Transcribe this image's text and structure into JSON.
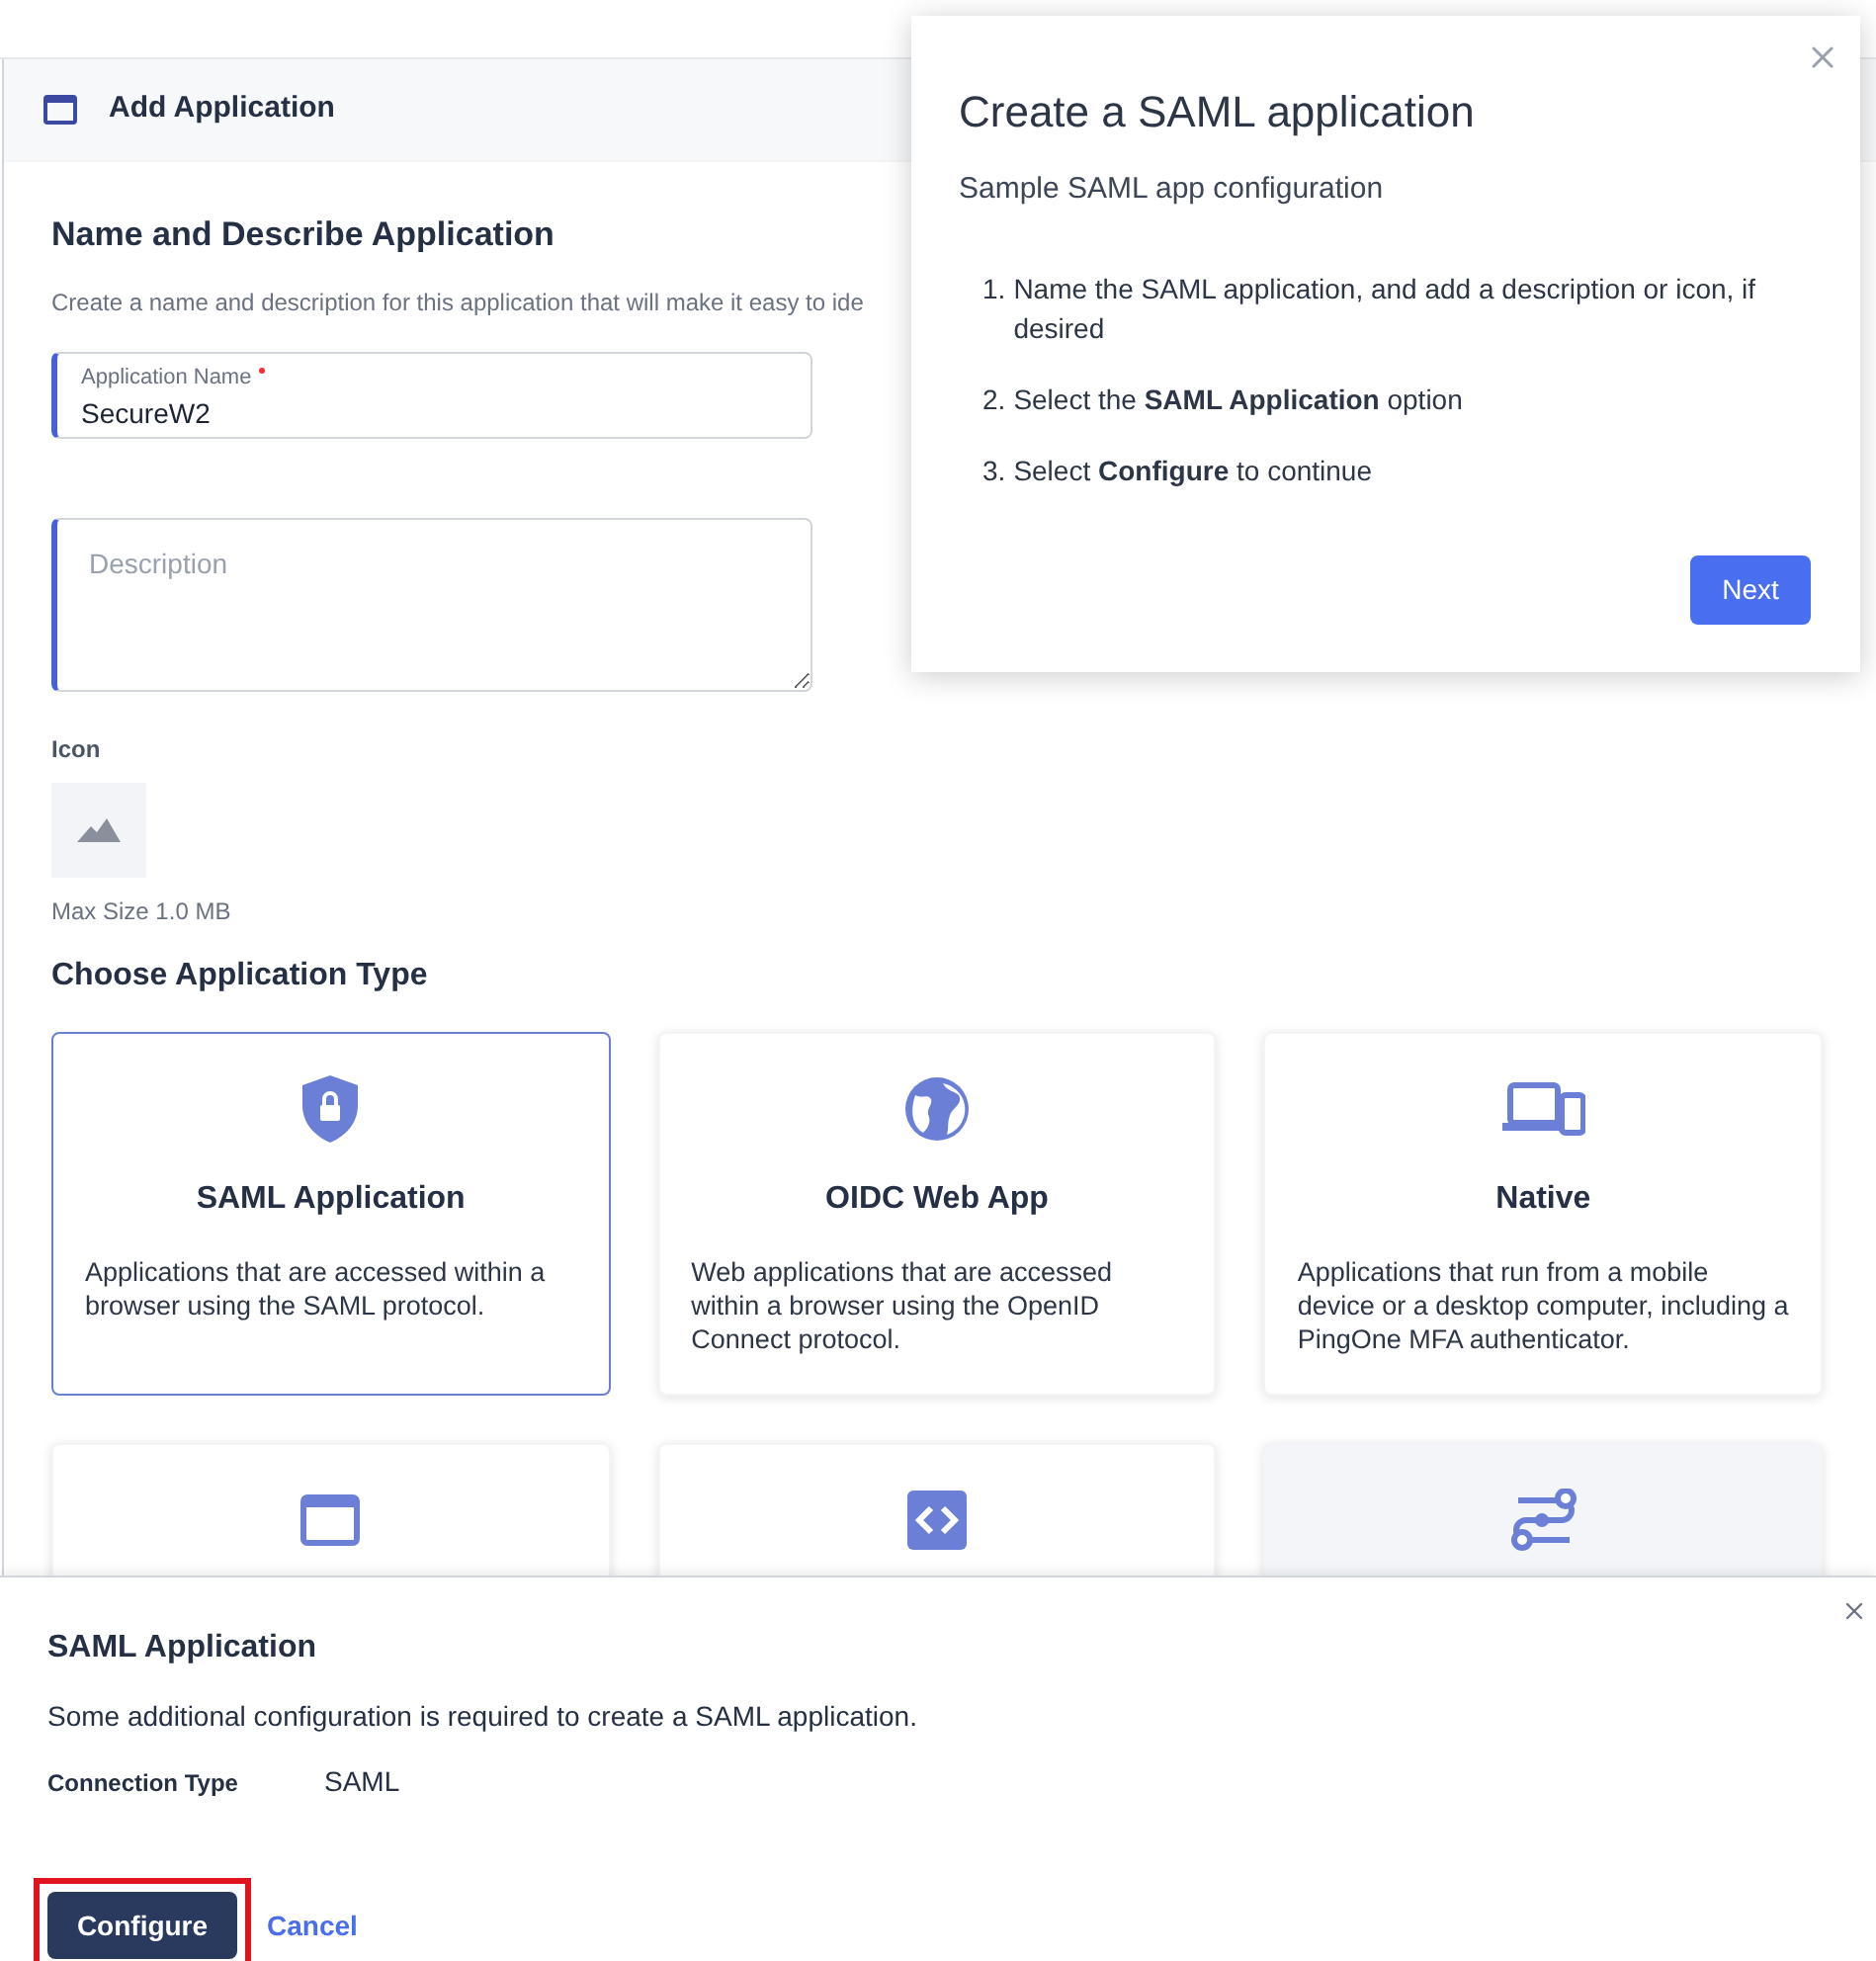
{
  "header": {
    "title": "Add Application"
  },
  "form": {
    "heading": "Name and Describe Application",
    "intro": "Create a name and description for this application that will make it easy to ide",
    "name_field": {
      "label": "Application Name",
      "required": true,
      "value": "SecureW2"
    },
    "description_field": {
      "placeholder": "Description"
    },
    "icon_label": "Icon",
    "icon_hint": "Max Size 1.0 MB"
  },
  "app_types": {
    "heading": "Choose Application Type",
    "cards": [
      {
        "kind": "shield",
        "title": "SAML Application",
        "text": "Applications that are accessed within a browser using the SAML protocol.",
        "selected": true,
        "hovered": false
      },
      {
        "kind": "globe",
        "title": "OIDC Web App",
        "text": "Web applications that are accessed within a browser using the OpenID Connect protocol.",
        "selected": false,
        "hovered": false
      },
      {
        "kind": "devices",
        "title": "Native",
        "text": "Applications that run from a mobile device or a desktop computer, including a PingOne MFA authenticator.",
        "selected": false,
        "hovered": false
      },
      {
        "kind": "window",
        "selected": false,
        "hovered": false
      },
      {
        "kind": "code",
        "selected": false,
        "hovered": false
      },
      {
        "kind": "flow",
        "selected": false,
        "hovered": true
      }
    ]
  },
  "guide_popover": {
    "title": "Create a SAML application",
    "subtitle": "Sample SAML app configuration",
    "steps": [
      "Name the SAML application, and add a description or icon, if desired",
      "Select the **SAML Application** option",
      "Select **Configure** to continue"
    ],
    "step_numbers": [
      "1.",
      "2.",
      "3."
    ],
    "next_button": "Next"
  },
  "config_panel": {
    "title": "SAML Application",
    "text": "Some additional configuration is required to create a SAML application.",
    "connection_type_label": "Connection Type",
    "connection_type_value": "SAML",
    "configure_button": "Configure",
    "configure_highlighted": true,
    "cancel_link": "Cancel"
  }
}
